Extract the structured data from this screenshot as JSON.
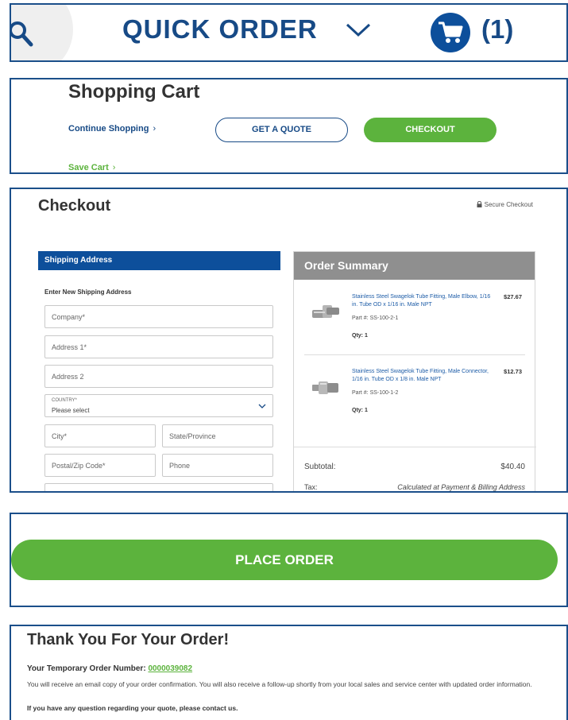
{
  "header": {
    "quick_order": "QUICK ORDER",
    "cart_count": "(1)",
    "icons": [
      "search-icon",
      "chevron-down-icon",
      "cart-icon"
    ],
    "brand_color": "#174a86"
  },
  "cart": {
    "title": "Shopping Cart",
    "continue_label": "Continue Shopping",
    "save_label": "Save Cart",
    "quote_label": "GET A QUOTE",
    "checkout_label": "CHECKOUT",
    "accent_color": "#5cb33d"
  },
  "checkout": {
    "title": "Checkout",
    "secure_label": "Secure Checkout",
    "shipping_header": "Shipping Address",
    "enter_new": "Enter New Shipping Address",
    "fields": {
      "company": "Company*",
      "address1": "Address 1*",
      "address2": "Address 2",
      "country_label": "COUNTRY*",
      "country_value": "Please select",
      "city": "City*",
      "state": "State/Province",
      "postal": "Postal/Zip Code*",
      "phone": "Phone"
    },
    "summary": {
      "title": "Order Summary",
      "items": [
        {
          "name": "Stainless Steel Swagelok Tube Fitting, Male Elbow, 1/16 in. Tube OD x 1/16 in. Male NPT",
          "price": "$27.67",
          "part": "Part #: SS-100-2-1",
          "qty": "Qty: 1"
        },
        {
          "name": "Stainless Steel Swagelok Tube Fitting, Male Connector, 1/16 in. Tube OD x 1/8 in. Male NPT",
          "price": "$12.73",
          "part": "Part #: SS-100-1-2",
          "qty": "Qty: 1"
        }
      ],
      "subtotal_label": "Subtotal:",
      "subtotal_value": "$40.40",
      "tax_label": "Tax:",
      "tax_value": "Calculated at Payment & Billing Address"
    }
  },
  "place_order": {
    "label": "PLACE ORDER"
  },
  "thank_you": {
    "title": "Thank You For Your Order!",
    "order_label": "Your Temporary Order Number: ",
    "order_number": "0000039082",
    "message": "You will receive an email copy of your order confirmation. You will also receive a follow-up shortly from your local sales and service center with updated order information.",
    "question": "If you have any question regarding your quote, please contact us."
  }
}
